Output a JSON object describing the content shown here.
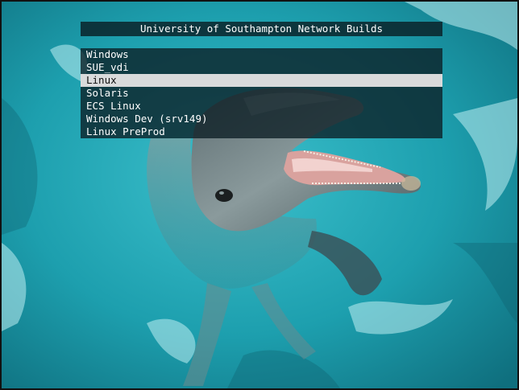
{
  "menu": {
    "title": "University of Southampton Network Builds",
    "items": [
      {
        "label": "Windows"
      },
      {
        "label": "SUE_vdi"
      },
      {
        "label": "Linux"
      },
      {
        "label": "Solaris"
      },
      {
        "label": "ECS Linux"
      },
      {
        "label": "Windows Dev (srv149)"
      },
      {
        "label": "Linux PreProd"
      }
    ],
    "selected_index": 2
  },
  "colors": {
    "menu_background": "#0c1e24",
    "highlight": "#d9dadb",
    "text": "#ffffff",
    "highlight_text": "#111111",
    "water": "#1fa3b0"
  }
}
